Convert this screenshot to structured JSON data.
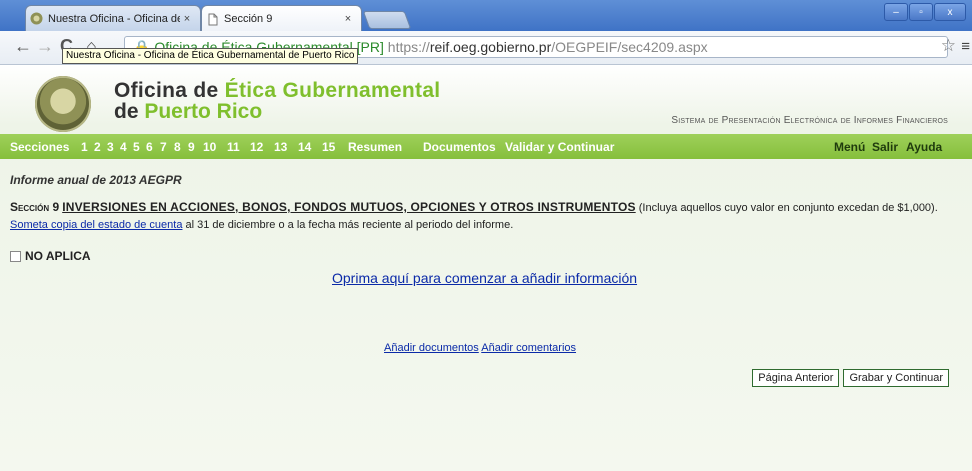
{
  "browser": {
    "tabs": [
      {
        "title": "Nuestra Oficina - Oficina de |",
        "close": "×"
      },
      {
        "title": "Sección 9",
        "close": "×"
      }
    ],
    "window_buttons": {
      "minimize": "–",
      "maximize": "▫",
      "close": "x"
    },
    "url": {
      "lock": "🔒",
      "org_label": "Oficina de Ética Gubernamental [PR]",
      "scheme": "https://",
      "host": "reif.oeg.gobierno.pr",
      "path": "/OEGPEIF/sec4209.aspx"
    },
    "tooltip": "Nuestra Oficina - Oficina de Ética Gubernamental de Puerto Rico",
    "nav": {
      "back": "←",
      "forward": "→",
      "reload": "C",
      "home": "⌂"
    },
    "star": "☆",
    "menu": "≡"
  },
  "header": {
    "brand_line1_a": "Oficina de ",
    "brand_line1_b": "Ética Gubernamental",
    "brand_line2_a": "de ",
    "brand_line2_b": "Puerto Rico",
    "system_name": "Sistema de Presentación Electrónica de Informes Financieros"
  },
  "nav": {
    "secciones": "Secciones",
    "numbers": [
      "1",
      "2",
      "3",
      "4",
      "5",
      "6",
      "7",
      "8",
      "9",
      "10",
      "11",
      "12",
      "13",
      "14",
      "15"
    ],
    "resumen": "Resumen",
    "documentos": "Documentos",
    "validar": "Validar y Continuar",
    "menu": "Menú",
    "salir": "Salir",
    "ayuda": "Ayuda"
  },
  "content": {
    "report_title": "Informe anual de 2013 AEGPR",
    "section_label": "Sección 9",
    "section_heading": "INVERSIONES EN ACCIONES, BONOS, FONDOS MUTUOS, OPCIONES Y OTROS INSTRUMENTOS",
    "section_text_1": " (Incluya aquellos cuyo valor en conjunto excedan de $1,000). ",
    "section_link": "Someta copia del estado de cuenta",
    "section_text_2": " al 31 de diciembre o a la fecha más reciente al periodo del informe.",
    "no_aplica": "NO APLICA",
    "start_link": "Oprima aquí para comenzar a añadir información",
    "add_docs": "Añadir documentos",
    "add_comments": "Añadir comentarios",
    "btn_prev": "Página Anterior",
    "btn_save": "Grabar y Continuar"
  },
  "colors": {
    "accent_green": "#86bf3c",
    "link_blue": "#0b2aa8",
    "chrome_blue": "#4a78c7"
  }
}
